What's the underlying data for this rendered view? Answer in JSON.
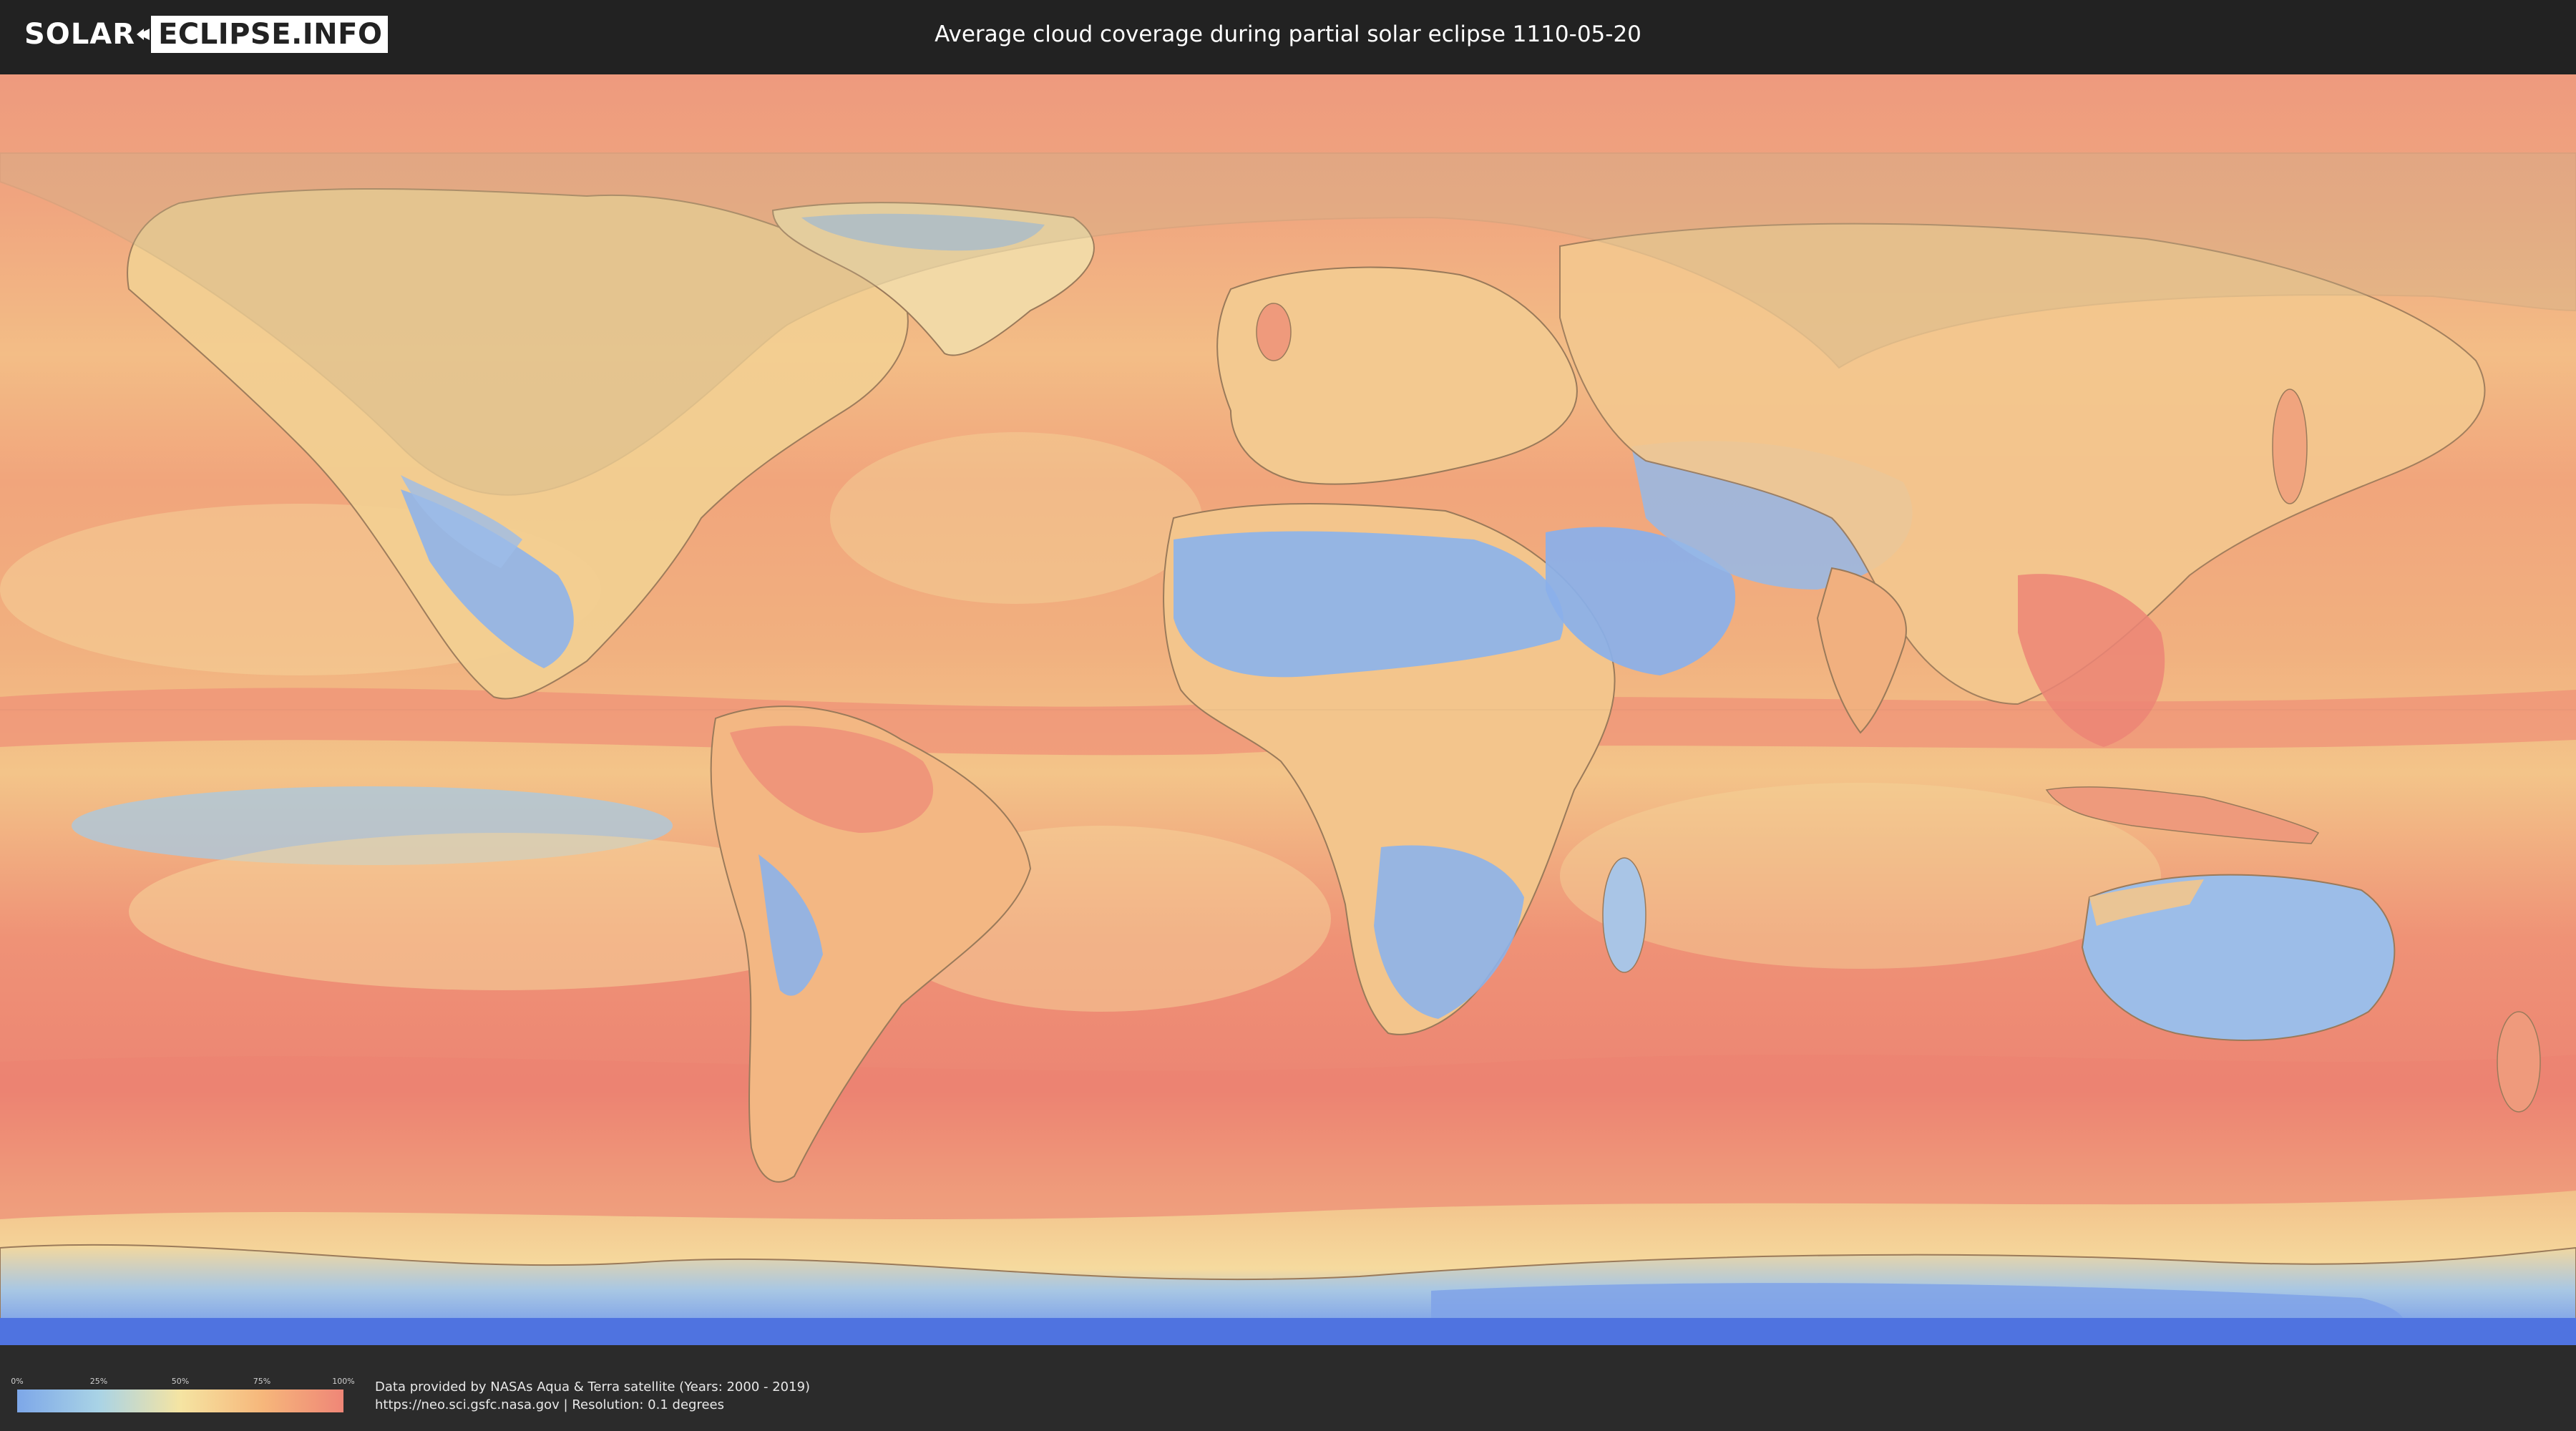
{
  "header": {
    "logo_left": "SOLAR",
    "logo_right": "ECLIPSE.INFO",
    "title": "Average cloud coverage during partial solar eclipse 1110-05-20"
  },
  "legend": {
    "ticks": [
      "0%",
      "25%",
      "50%",
      "75%",
      "100%"
    ],
    "colors": [
      "#7da7e8",
      "#a9d3e6",
      "#f5e4a2",
      "#f6b77b",
      "#ef8677"
    ]
  },
  "credits": {
    "line1": "Data provided by NASAs Aqua & Terra satellite (Years: 2000 - 2019)",
    "line2": "https://neo.sci.gsfc.nasa.gov | Resolution: 0.1 degrees"
  },
  "map": {
    "projection": "equirectangular",
    "overlay": "partial eclipse visibility area (northern hemisphere)",
    "colors": {
      "ocean_cloudy": "#ed8c74",
      "mid": "#f4c48a",
      "land_low": "#f3dc9c",
      "clear": "#8db4ea",
      "polar_clear": "#5a82e6",
      "overlay": "#c8b48c"
    }
  }
}
